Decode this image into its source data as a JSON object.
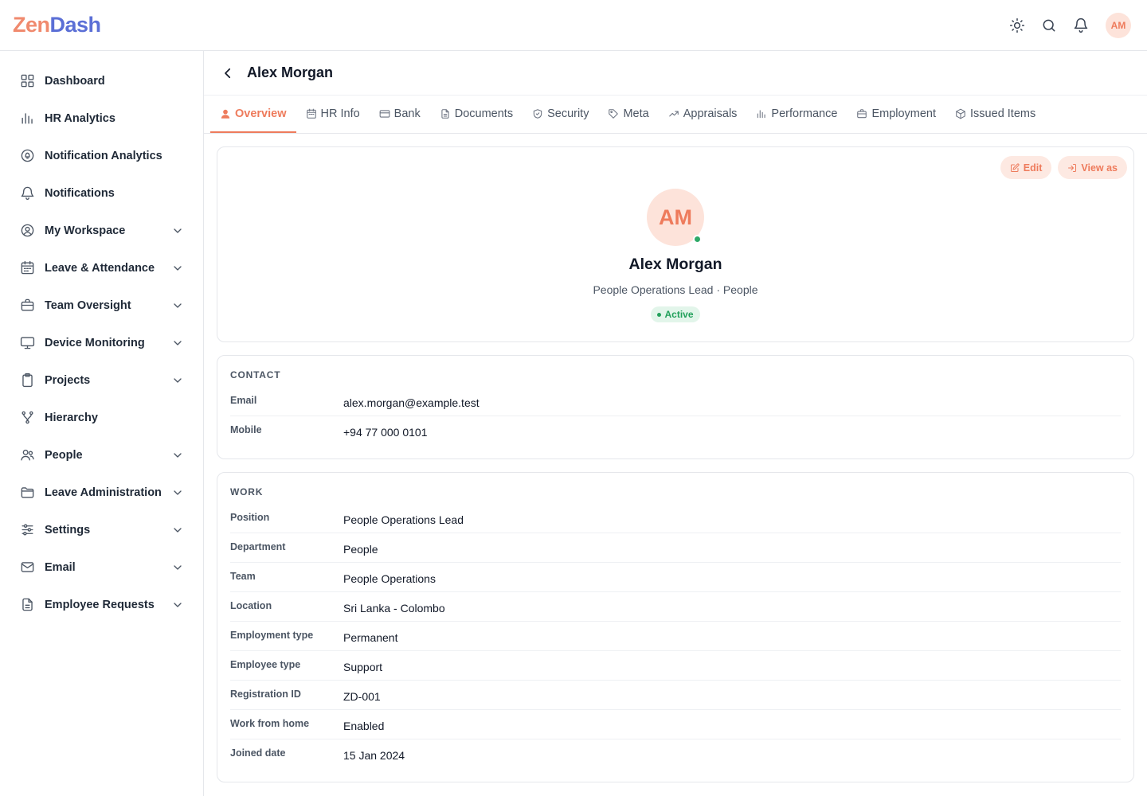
{
  "app": {
    "logo_part1": "Zen",
    "logo_part2": "Dash",
    "user_initials": "AM"
  },
  "sidebar": {
    "items": [
      {
        "label": "Dashboard",
        "icon": "grid-icon",
        "has_children": false
      },
      {
        "label": "HR Analytics",
        "icon": "bar-chart-icon",
        "has_children": false
      },
      {
        "label": "Notification Analytics",
        "icon": "analytics-bell-icon",
        "has_children": false
      },
      {
        "label": "Notifications",
        "icon": "bell-icon",
        "has_children": false
      },
      {
        "label": "My Workspace",
        "icon": "user-circle-icon",
        "has_children": true
      },
      {
        "label": "Leave & Attendance",
        "icon": "calendar-icon",
        "has_children": true
      },
      {
        "label": "Team Oversight",
        "icon": "briefcase-icon",
        "has_children": true
      },
      {
        "label": "Device Monitoring",
        "icon": "monitor-icon",
        "has_children": true
      },
      {
        "label": "Projects",
        "icon": "clipboard-icon",
        "has_children": true
      },
      {
        "label": "Hierarchy",
        "icon": "hierarchy-icon",
        "has_children": false
      },
      {
        "label": "People",
        "icon": "users-icon",
        "has_children": true
      },
      {
        "label": "Leave Administration",
        "icon": "folder-icon",
        "has_children": true
      },
      {
        "label": "Settings",
        "icon": "sliders-icon",
        "has_children": true
      },
      {
        "label": "Email",
        "icon": "mail-icon",
        "has_children": true
      },
      {
        "label": "Employee Requests",
        "icon": "document-icon",
        "has_children": true
      }
    ]
  },
  "page": {
    "title": "Alex Morgan"
  },
  "tabs": [
    {
      "label": "Overview",
      "icon": "user-icon",
      "active": true
    },
    {
      "label": "HR Info",
      "icon": "calendar-icon",
      "active": false
    },
    {
      "label": "Bank",
      "icon": "card-icon",
      "active": false
    },
    {
      "label": "Documents",
      "icon": "document-icon",
      "active": false
    },
    {
      "label": "Security",
      "icon": "shield-icon",
      "active": false
    },
    {
      "label": "Meta",
      "icon": "tag-icon",
      "active": false
    },
    {
      "label": "Appraisals",
      "icon": "trend-icon",
      "active": false
    },
    {
      "label": "Performance",
      "icon": "bar-chart-icon",
      "active": false
    },
    {
      "label": "Employment",
      "icon": "briefcase-icon",
      "active": false
    },
    {
      "label": "Issued Items",
      "icon": "box-icon",
      "active": false
    }
  ],
  "profile": {
    "initials": "AM",
    "name": "Alex Morgan",
    "subtitle": "People Operations Lead · People",
    "status": "Active",
    "edit_label": "Edit",
    "view_as_label": "View as"
  },
  "contact": {
    "title": "CONTACT",
    "rows": [
      {
        "key": "Email",
        "value": "alex.morgan@example.test"
      },
      {
        "key": "Mobile",
        "value": "+94 77 000 0101"
      }
    ]
  },
  "work": {
    "title": "WORK",
    "rows": [
      {
        "key": "Position",
        "value": "People Operations Lead"
      },
      {
        "key": "Department",
        "value": "People"
      },
      {
        "key": "Team",
        "value": "People Operations"
      },
      {
        "key": "Location",
        "value": "Sri Lanka - Colombo"
      },
      {
        "key": "Employment type",
        "value": "Permanent"
      },
      {
        "key": "Employee type",
        "value": "Support"
      },
      {
        "key": "Registration ID",
        "value": "ZD-001"
      },
      {
        "key": "Work from home",
        "value": "Enabled"
      },
      {
        "key": "Joined date",
        "value": "15 Jan 2024"
      }
    ]
  },
  "colors": {
    "accent": "#ee7b5c",
    "accent_soft": "#fde9e2",
    "success": "#22a05b",
    "logo_blue": "#5b6fd6"
  }
}
